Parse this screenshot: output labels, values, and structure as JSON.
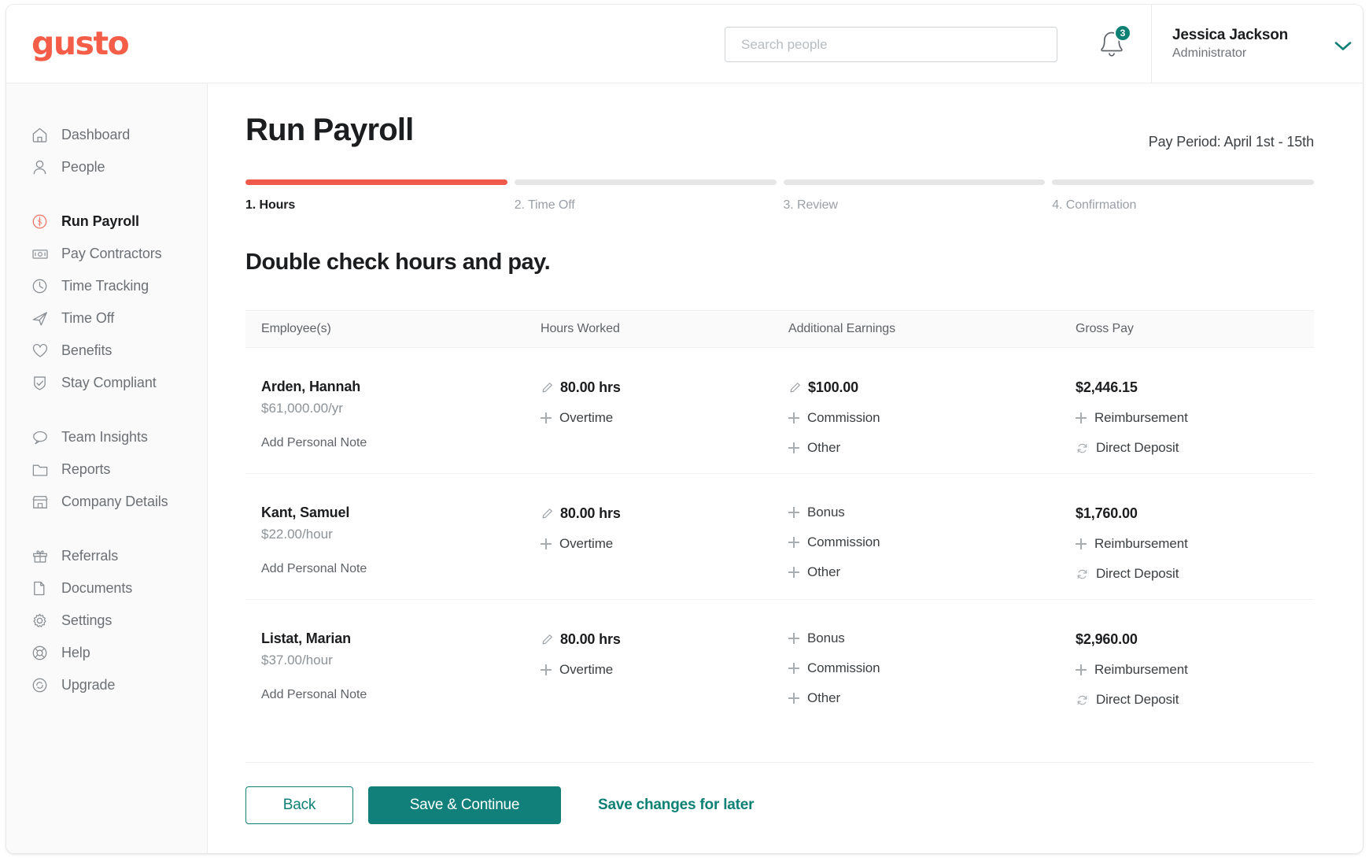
{
  "brand": {
    "logo_text": "gusto",
    "logo_color": "#f45d48",
    "accent_coral": "#f05a4a",
    "accent_teal": "#0e8074"
  },
  "header": {
    "search": {
      "placeholder": "Search people",
      "value": ""
    },
    "notifications": {
      "icon": "bell-icon",
      "count": "3"
    },
    "user": {
      "name": "Jessica Jackson",
      "role": "Administrator",
      "chevron": "chevron-down-icon"
    }
  },
  "sidebar": {
    "groups": [
      {
        "items": [
          {
            "label": "Dashboard",
            "icon": "home-icon",
            "active": false
          },
          {
            "label": "People",
            "icon": "person-icon",
            "active": false
          }
        ]
      },
      {
        "items": [
          {
            "label": "Run Payroll",
            "icon": "dollar-circle-icon",
            "active": true
          },
          {
            "label": "Pay Contractors",
            "icon": "money-bill-icon",
            "active": false
          },
          {
            "label": "Time Tracking",
            "icon": "clock-icon",
            "active": false
          },
          {
            "label": "Time Off",
            "icon": "airplane-icon",
            "active": false
          },
          {
            "label": "Benefits",
            "icon": "heart-icon",
            "active": false
          },
          {
            "label": "Stay Compliant",
            "icon": "shield-check-icon",
            "active": false
          }
        ]
      },
      {
        "items": [
          {
            "label": "Team Insights",
            "icon": "speech-bubble-icon",
            "active": false
          },
          {
            "label": "Reports",
            "icon": "folder-icon",
            "active": false
          },
          {
            "label": "Company Details",
            "icon": "storefront-icon",
            "active": false
          }
        ]
      },
      {
        "items": [
          {
            "label": "Referrals",
            "icon": "gift-icon",
            "active": false
          },
          {
            "label": "Documents",
            "icon": "document-icon",
            "active": false
          },
          {
            "label": "Settings",
            "icon": "gear-icon",
            "active": false
          },
          {
            "label": "Help",
            "icon": "lifebuoy-icon",
            "active": false
          },
          {
            "label": "Upgrade",
            "icon": "refresh-circle-icon",
            "active": false
          }
        ]
      }
    ]
  },
  "page": {
    "title": "Run Payroll",
    "pay_period": "Pay Period: April 1st - 15th",
    "section_title": "Double check hours and pay.",
    "steps": [
      {
        "label": "1. Hours",
        "state": "current"
      },
      {
        "label": "2. Time Off",
        "state": "upcoming"
      },
      {
        "label": "3. Review",
        "state": "upcoming"
      },
      {
        "label": "4. Confirmation",
        "state": "upcoming"
      }
    ]
  },
  "table": {
    "columns": [
      "Employee(s)",
      "Hours Worked",
      "Additional Earnings",
      "Gross Pay"
    ],
    "rows": [
      {
        "employee": "Arden, Hannah",
        "rate": "$61,000.00/yr",
        "note_link": "Add Personal Note",
        "hours_value": "80.00 hrs",
        "hours_actions": [
          "Overtime"
        ],
        "earnings_value": "$100.00",
        "earnings_has_edit": true,
        "earnings_actions": [
          "Commission",
          "Other"
        ],
        "gross_value": "$2,446.15",
        "gross_actions": [
          "Reimbursement"
        ],
        "payment_method": "Direct Deposit"
      },
      {
        "employee": "Kant, Samuel",
        "rate": "$22.00/hour",
        "note_link": "Add Personal Note",
        "hours_value": "80.00 hrs",
        "hours_actions": [
          "Overtime"
        ],
        "earnings_value": "",
        "earnings_has_edit": false,
        "earnings_actions": [
          "Bonus",
          "Commission",
          "Other"
        ],
        "gross_value": "$1,760.00",
        "gross_actions": [
          "Reimbursement"
        ],
        "payment_method": "Direct Deposit"
      },
      {
        "employee": "Listat, Marian",
        "rate": "$37.00/hour",
        "note_link": "Add Personal Note",
        "hours_value": "80.00 hrs",
        "hours_actions": [
          "Overtime"
        ],
        "earnings_value": "",
        "earnings_has_edit": false,
        "earnings_actions": [
          "Bonus",
          "Commission",
          "Other"
        ],
        "gross_value": "$2,960.00",
        "gross_actions": [
          "Reimbursement"
        ],
        "payment_method": "Direct Deposit"
      }
    ]
  },
  "footer": {
    "back_label": "Back",
    "save_continue_label": "Save & Continue",
    "save_later_label": "Save changes for later"
  }
}
